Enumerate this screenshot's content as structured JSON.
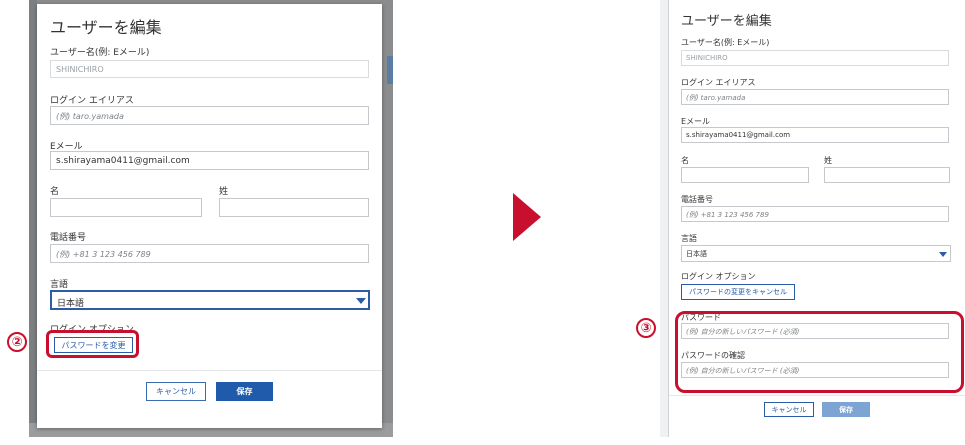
{
  "colors": {
    "accent": "#1f5baa",
    "highlight": "#c8102e"
  },
  "step_left": "②",
  "step_right": "③",
  "left": {
    "title": "ユーザーを編集",
    "username_label": "ユーザー名(例: Eメール)",
    "username_value": "SHINICHIRO",
    "alias_label": "ログイン エイリアス",
    "alias_placeholder": "(例) taro.yamada",
    "email_label": "Eメール",
    "email_value": "s.shirayama0411@gmail.com",
    "first_name_label": "名",
    "last_name_label": "姓",
    "phone_label": "電話番号",
    "phone_placeholder": "(例) +81 3 123 456 789",
    "language_label": "言語",
    "language_value": "日本語",
    "login_option_label": "ログイン オプション",
    "change_password_button": "パスワードを変更",
    "cancel_button": "キャンセル",
    "save_button": "保存"
  },
  "right": {
    "title": "ユーザーを編集",
    "username_label": "ユーザー名(例: Eメール)",
    "username_value": "SHINICHIRO",
    "alias_label": "ログイン エイリアス",
    "alias_placeholder": "(例) taro.yamada",
    "email_label": "Eメール",
    "email_value": "s.shirayama0411@gmail.com",
    "first_name_label": "名",
    "last_name_label": "姓",
    "phone_label": "電話番号",
    "phone_placeholder": "(例) +81 3 123 456 789",
    "language_label": "言語",
    "language_value": "日本語",
    "login_option_label": "ログイン オプション",
    "cancel_password_change_button": "パスワードの変更をキャンセル",
    "password_label": "パスワード",
    "password_placeholder": "(例) 自分の新しいパスワード (必須)",
    "password_confirm_label": "パスワードの確認",
    "password_confirm_placeholder": "(例) 自分の新しいパスワード (必須)",
    "cancel_button": "キャンセル",
    "save_button": "保存"
  }
}
